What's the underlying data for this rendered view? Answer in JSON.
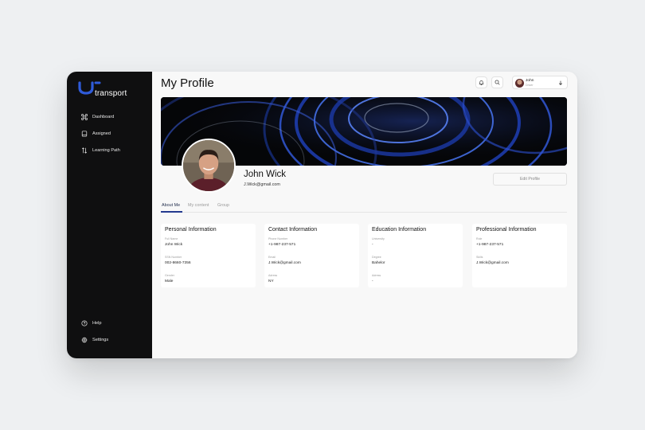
{
  "brand": {
    "name": "transport",
    "accent": "#2f5bd9"
  },
  "sidebar": {
    "items": [
      {
        "label": "Dashboard",
        "icon": "command-icon"
      },
      {
        "label": "Assigned",
        "icon": "book-icon"
      },
      {
        "label": "Learning Path",
        "icon": "sort-arrows-icon"
      }
    ],
    "bottom": [
      {
        "label": "Help",
        "icon": "help-circle-icon"
      },
      {
        "label": "Settings",
        "icon": "gear-icon"
      }
    ]
  },
  "header": {
    "title": "My Profile",
    "user": {
      "name": "John",
      "role": "Driver"
    }
  },
  "profile": {
    "name": "John Wick",
    "email": "J.Wick@gmail.com",
    "edit_label": "Edit Profile"
  },
  "tabs": [
    "About Me",
    "My content",
    "Group"
  ],
  "cards": [
    {
      "title": "Personal Information",
      "fields": [
        {
          "label": "Full Name",
          "value": "John Wick"
        },
        {
          "label": "SSN Number",
          "value": "002-8660-7356"
        },
        {
          "label": "Gender",
          "value": "Male"
        }
      ]
    },
    {
      "title": "Contact Information",
      "fields": [
        {
          "label": "Phone Number",
          "value": "+1-987-237-571"
        },
        {
          "label": "Email",
          "value": "J.Wick@gmail.com"
        },
        {
          "label": "Adress",
          "value": "NY"
        }
      ]
    },
    {
      "title": "Education Information",
      "fields": [
        {
          "label": "University",
          "value": "-"
        },
        {
          "label": "Degree",
          "value": "Bahelor"
        },
        {
          "label": "Adress",
          "value": "-"
        }
      ]
    },
    {
      "title": "Professional Information",
      "fields": [
        {
          "label": "Role",
          "value": "+1-987-237-571"
        },
        {
          "label": "Skills",
          "value": "J.Wick@gmail.com"
        }
      ]
    }
  ]
}
